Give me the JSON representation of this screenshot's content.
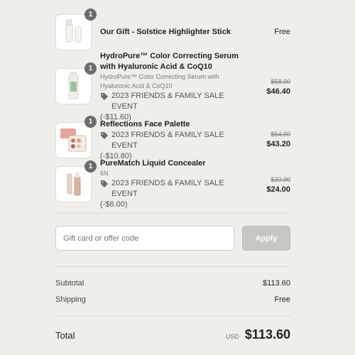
{
  "items": [
    {
      "quantity": "1",
      "title": "Our Gift - Solstice Highlighter Stick",
      "variant": "",
      "discount_label": "",
      "discount_amount": "",
      "old_price": "",
      "price": "Free"
    },
    {
      "quantity": "1",
      "title": "HydroPure™ Color Correcting Serum with Hyaluronic Acid & CoQ10",
      "variant": "HydroPure™ Color Correcting Serum with Hyaluronic Acid & CoQ10",
      "discount_label": "2023 FRIENDS & FAMILY SALE EVENT",
      "discount_amount": "(-$11.60)",
      "old_price": "$58.00",
      "price": "$46.40"
    },
    {
      "quantity": "1",
      "title": "Reflections Face Palette",
      "variant": "",
      "discount_label": "2023 FRIENDS & FAMILY SALE EVENT",
      "discount_amount": "(-$10.80)",
      "old_price": "$54.00",
      "price": "$43.20"
    },
    {
      "quantity": "1",
      "title": "PureMatch Liquid Concealer",
      "variant": "6N",
      "discount_label": "2023 FRIENDS & FAMILY SALE EVENT",
      "discount_amount": "(-$6.00)",
      "old_price": "$30.00",
      "price": "$24.00"
    }
  ],
  "discount_icon": "tag-icon",
  "code": {
    "placeholder": "Gift card or offer code",
    "value": "",
    "apply_label": "Apply"
  },
  "summary": {
    "subtotal_label": "Subtotal",
    "subtotal_value": "$113.60",
    "shipping_label": "Shipping",
    "shipping_value": "Free",
    "total_label": "Total",
    "currency": "USD",
    "total_value": "$113.60"
  },
  "colors": {
    "background": "#f0eeeb",
    "apply_button": "#c8c6c3",
    "quantity_badge": "#6b6b6b"
  }
}
